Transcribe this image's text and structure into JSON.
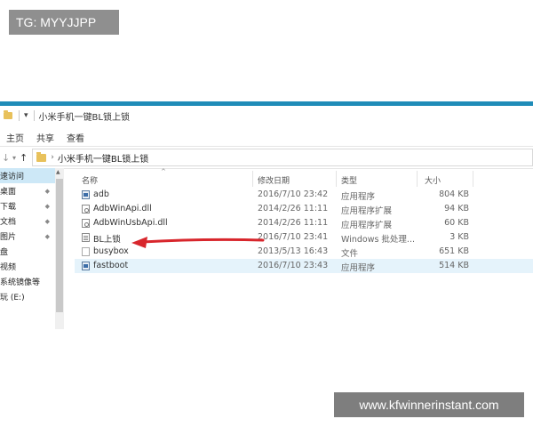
{
  "overlay": {
    "tg_text": "TG: MYYJJPP",
    "watermark_text": "www.kfwinnerinstant.com"
  },
  "window": {
    "title": "小米手机一键BL锁上锁",
    "title_dropdown": "▾",
    "accent_color": "#1f8cb8"
  },
  "ribbon": {
    "tabs": [
      "主页",
      "共享",
      "查看"
    ]
  },
  "address": {
    "forward_icon": "↓",
    "up_icon": "↑",
    "separator": "›",
    "crumb": "小米手机一键BL锁上锁"
  },
  "nav_pane": {
    "items": [
      {
        "label": "速访问",
        "selected": true,
        "pinned": false
      },
      {
        "label": "桌面",
        "selected": false,
        "pinned": true
      },
      {
        "label": "下载",
        "selected": false,
        "pinned": true
      },
      {
        "label": "文档",
        "selected": false,
        "pinned": true
      },
      {
        "label": "图片",
        "selected": false,
        "pinned": true
      },
      {
        "label": "盘",
        "selected": false,
        "pinned": false
      },
      {
        "label": "视频",
        "selected": false,
        "pinned": false
      },
      {
        "label": "系统镜像等",
        "selected": false,
        "pinned": false
      },
      {
        "label": "玩 (E:)",
        "selected": false,
        "pinned": false
      }
    ],
    "pin_icon": "📌"
  },
  "file_list": {
    "columns": {
      "name": "名称",
      "date": "修改日期",
      "type": "类型",
      "size": "大小"
    },
    "rows": [
      {
        "name": "adb",
        "date": "2016/7/10 23:42",
        "type": "应用程序",
        "size": "804 KB",
        "icon": "exe",
        "selected": false
      },
      {
        "name": "AdbWinApi.dll",
        "date": "2014/2/26 11:11",
        "type": "应用程序扩展",
        "size": "94 KB",
        "icon": "dll",
        "selected": false
      },
      {
        "name": "AdbWinUsbApi.dll",
        "date": "2014/2/26 11:11",
        "type": "应用程序扩展",
        "size": "60 KB",
        "icon": "dll",
        "selected": false
      },
      {
        "name": "BL上锁",
        "date": "2016/7/10 23:41",
        "type": "Windows 批处理...",
        "size": "3 KB",
        "icon": "bat",
        "selected": false
      },
      {
        "name": "busybox",
        "date": "2013/5/13 16:43",
        "type": "文件",
        "size": "651 KB",
        "icon": "plain",
        "selected": false
      },
      {
        "name": "fastboot",
        "date": "2016/7/10 23:43",
        "type": "应用程序",
        "size": "514 KB",
        "icon": "exe",
        "selected": true
      }
    ]
  },
  "annotation": {
    "arrow_color": "#d8262c"
  }
}
